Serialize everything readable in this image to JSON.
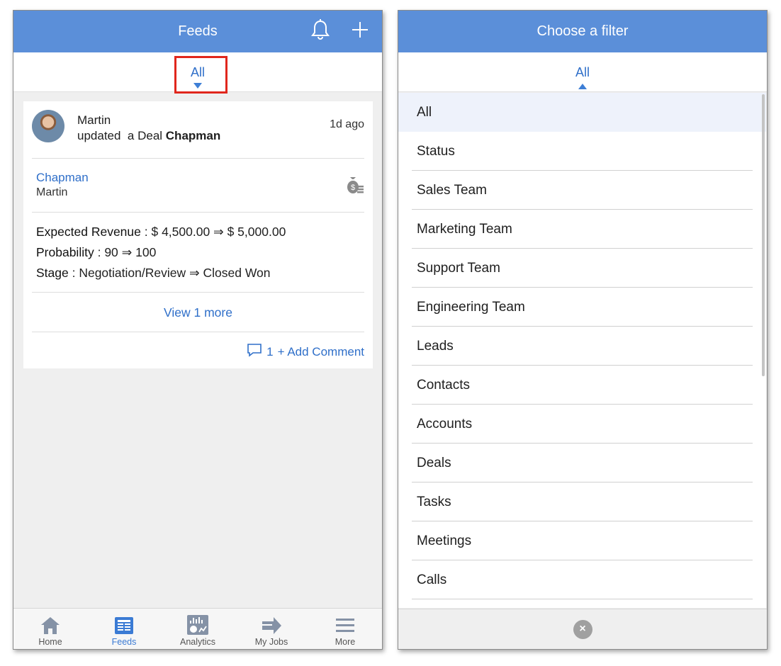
{
  "feeds": {
    "header_title": "Feeds",
    "filter_label": "All",
    "post": {
      "user": "Martin",
      "action_verb": "updated",
      "object_type": "a Deal",
      "object_name": "Chapman",
      "time_ago": "1d ago",
      "deal_name": "Chapman",
      "deal_owner": "Martin",
      "changes": [
        {
          "label": "Expected Revenue",
          "sep": " : ",
          "value": "$ 4,500.00 ⇒ $ 5,000.00"
        },
        {
          "label": "Probability",
          "sep": " : ",
          "value": "90 ⇒ 100"
        },
        {
          "label": "Stage",
          "sep": " : ",
          "value": "Negotiation/Review ⇒ Closed Won"
        }
      ],
      "view_more": "View 1 more",
      "comment_count": "1",
      "add_comment": "+ Add Comment"
    },
    "tabs": [
      {
        "label": "Home",
        "icon": "home-icon"
      },
      {
        "label": "Feeds",
        "icon": "feeds-icon",
        "active": true
      },
      {
        "label": "Analytics",
        "icon": "analytics-icon"
      },
      {
        "label": "My Jobs",
        "icon": "my-jobs-icon"
      },
      {
        "label": "More",
        "icon": "menu-icon"
      }
    ]
  },
  "filter_panel": {
    "header_title": "Choose a filter",
    "current": "All",
    "options": [
      "All",
      "Status",
      "Sales Team",
      "Marketing Team",
      "Support Team",
      "Engineering Team",
      "Leads",
      "Contacts",
      "Accounts",
      "Deals",
      "Tasks",
      "Meetings",
      "Calls"
    ],
    "close_glyph": "×"
  },
  "colors": {
    "header_blue": "#5b8fd9",
    "link_blue": "#2f6fc9",
    "highlight_red": "#e0271d"
  }
}
